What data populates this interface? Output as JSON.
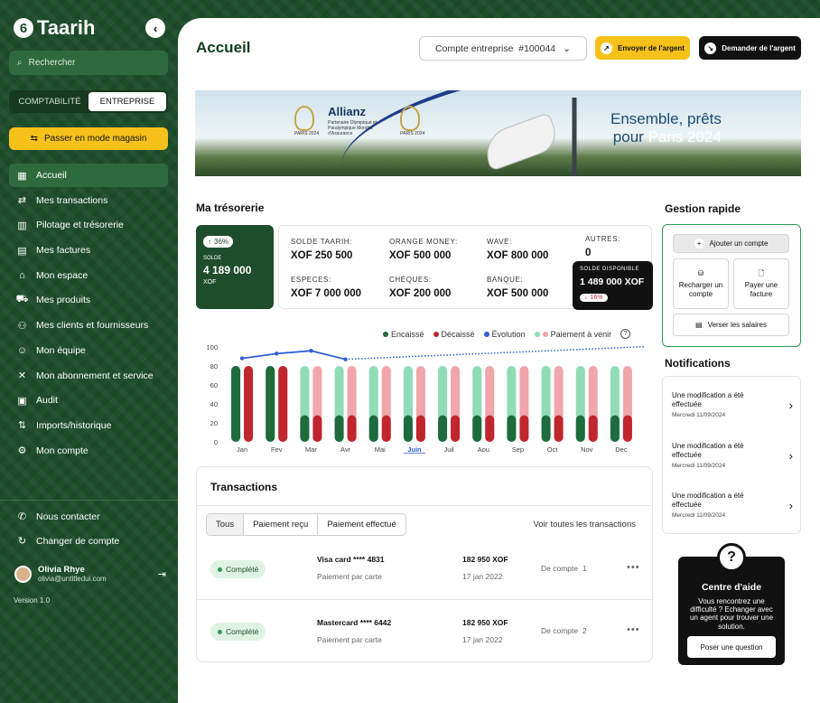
{
  "app": {
    "brand": "Taarih",
    "brand_mark": "6",
    "version": "Version 1.0"
  },
  "sidebar": {
    "search_placeholder": "Rechercher",
    "segments": [
      "COMPTABILITÉ",
      "ENTREPRISE"
    ],
    "shop_mode": "Passer en mode magasin",
    "items": [
      {
        "label": "Accueil",
        "icon": "grid-icon"
      },
      {
        "label": "Mes transactions",
        "icon": "arrows-icon"
      },
      {
        "label": "Pilotage et trésorerie",
        "icon": "chart-icon"
      },
      {
        "label": "Mes factures",
        "icon": "invoice-icon"
      },
      {
        "label": "Mon espace",
        "icon": "home-icon"
      },
      {
        "label": "Mes produits",
        "icon": "cart-icon"
      },
      {
        "label": "Mes clients et fournisseurs",
        "icon": "users-icon"
      },
      {
        "label": "Mon équipe",
        "icon": "user-icon"
      },
      {
        "label": "Mon abonnement et service",
        "icon": "tools-icon"
      },
      {
        "label": "Audit",
        "icon": "clipboard-icon"
      },
      {
        "label": "Imports/historique",
        "icon": "sort-icon"
      },
      {
        "label": "Mon compte",
        "icon": "gear-icon"
      }
    ],
    "bottom": [
      {
        "label": "Nous contacter",
        "icon": "phone-icon"
      },
      {
        "label": "Changer de compte",
        "icon": "refresh-icon"
      }
    ],
    "user": {
      "name": "Olivia Rhye",
      "email": "olivia@untitledui.com"
    }
  },
  "header": {
    "title": "Accueil",
    "account": "Compte entreprise  #100044",
    "send": "Envoyer de l'argent",
    "request": "Demander de l'argent"
  },
  "banner": {
    "paris_text": "PARIS 2024",
    "allianz": "Allianz",
    "allianz_sub": "Partenaire Olympique et Paralympique Mondial d'Assurance",
    "tagline_1": "Ensemble, prêts",
    "tagline_2": "pour",
    "tagline_3": "Paris 2024"
  },
  "tresorerie": {
    "title": "Ma trésorerie",
    "solde_pct": "36%",
    "solde_label": "SOLDE",
    "solde_value": "4 189 000",
    "solde_currency": "XOF",
    "kpis": [
      {
        "label": "SOLDE TAARIH:",
        "value": "XOF 250 500"
      },
      {
        "label": "ORANGE MONEY:",
        "value": "XOF 500 000"
      },
      {
        "label": "WAVE:",
        "value": "XOF 800 000"
      },
      {
        "label": "AUTRES:",
        "value": "0"
      },
      {
        "label": "ESPECES:",
        "value": "XOF 7 000 000"
      },
      {
        "label": "CHÈQUES:",
        "value": "XOF 200 000"
      },
      {
        "label": "BANQUE:",
        "value": "XOF 500 000"
      }
    ],
    "dispo_label": "SOLDE DISPONIBLE",
    "dispo_value": "1 489 000 XOF",
    "dispo_pct": "16%"
  },
  "chart_data": {
    "type": "bar",
    "categories": [
      "Jan",
      "Fev",
      "Mar",
      "Avr",
      "Mai",
      "Juin",
      "Juil",
      "Aou",
      "Sep",
      "Oct",
      "Nov",
      "Dec"
    ],
    "selected": "Juin",
    "ylim": [
      0,
      100
    ],
    "yticks": [
      0,
      20,
      40,
      60,
      80,
      100
    ],
    "legend": [
      "Encaissé",
      "Décaissé",
      "Évolution",
      "Paiement à venir"
    ],
    "series": [
      {
        "name": "Encaissé",
        "values": [
          80,
          80,
          80,
          80,
          80,
          80,
          80,
          80,
          80,
          80,
          80,
          80
        ],
        "color": "#1e6b3d",
        "solid_until": [
          80,
          80,
          28,
          28,
          28,
          28,
          28,
          28,
          28,
          28,
          28,
          28
        ]
      },
      {
        "name": "Décaissé",
        "values": [
          80,
          80,
          80,
          80,
          80,
          80,
          80,
          80,
          80,
          80,
          80,
          80
        ],
        "color": "#c0262d",
        "solid_until": [
          80,
          80,
          28,
          28,
          28,
          28,
          28,
          28,
          28,
          28,
          28,
          28
        ]
      },
      {
        "name": "Évolution",
        "values": [
          88,
          93,
          96,
          87,
          null,
          null,
          null,
          null,
          null,
          null,
          null,
          106
        ],
        "color": "#2f5fd6"
      }
    ],
    "future_color_green": "#8fdcb5",
    "future_color_red": "#f0a6ab"
  },
  "transactions": {
    "title": "Transactions",
    "tabs": [
      "Tous",
      "Paiement reçu",
      "Paiement effectué"
    ],
    "see_all": "Voir toutes les transactions",
    "rows": [
      {
        "status": "Complété",
        "card": "Visa card **** 4831",
        "method": "Paiement par carte",
        "amount": "182 950 XOF",
        "date": "17 jan 2022",
        "account": "De compte  1"
      },
      {
        "status": "Complété",
        "card": "Mastercard **** 6442",
        "method": "Paiement par carte",
        "amount": "182 950 XOF",
        "date": "17 jan 2022",
        "account": "De compte  2"
      }
    ]
  },
  "gestion": {
    "title": "Gestion rapide",
    "add_account": "Ajouter un compte",
    "recharge": "Recharger un compte",
    "pay_invoice": "Payer une facture",
    "salaries": "Verser les salaires"
  },
  "notifications": {
    "title": "Notifications",
    "items": [
      {
        "text": "Une modification a été effectuée",
        "date": "Mercredi 11/09/2024"
      },
      {
        "text": "Une modification a été effectuée",
        "date": "Mercredi 11/09/2024"
      },
      {
        "text": "Une modification a été effectuée",
        "date": "Mercredi 11/09/2024"
      }
    ]
  },
  "aide": {
    "title": "Centre d'aide",
    "desc": "Vous rencontrez une difficulté ? Echanger avec un agent pour trouver une solution.",
    "button": "Poser une question"
  }
}
